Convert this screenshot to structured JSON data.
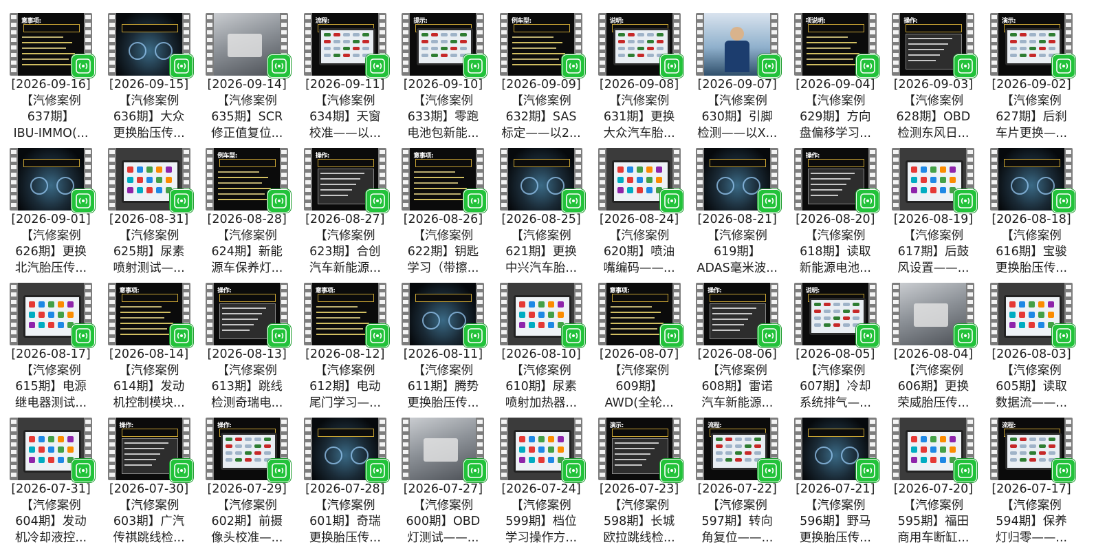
{
  "colors": {
    "badge": "#22c23a",
    "film": "#7d7d7d",
    "text": "#1f1f1f"
  },
  "badge_icon": "wifi-broadcast-icon",
  "items": [
    {
      "date": "[2026-09-16]",
      "l2": "【汽修案例",
      "l3": "637期】",
      "l4": "IBU-IMMO(...",
      "thumb": "dark-text",
      "tag": "意事项:"
    },
    {
      "date": "[2026-09-15]",
      "l2": "【汽修案例",
      "l3": "636期】大众",
      "l4": "更换胎压传...",
      "thumb": "dashboard",
      "tag": "操作:"
    },
    {
      "date": "[2026-09-14]",
      "l2": "【汽修案例",
      "l3": "635期】SCR",
      "l4": "修正值复位...",
      "thumb": "photo-gray",
      "tag": ""
    },
    {
      "date": "[2026-09-11]",
      "l2": "【汽修案例",
      "l3": "634期】天窗",
      "l4": "校准——以...",
      "thumb": "screen",
      "tag": "流程:"
    },
    {
      "date": "[2026-09-10]",
      "l2": "【汽修案例",
      "l3": "633期】零跑",
      "l4": "电池包新能...",
      "thumb": "screen",
      "tag": "提示:"
    },
    {
      "date": "[2026-09-09]",
      "l2": "【汽修案例",
      "l3": "632期】SAS",
      "l4": "标定——以2...",
      "thumb": "dark-text",
      "tag": "例车型:"
    },
    {
      "date": "[2026-09-08]",
      "l2": "【汽修案例",
      "l3": "631期】更换",
      "l4": "大众汽车胎...",
      "thumb": "screen",
      "tag": "说明:"
    },
    {
      "date": "[2026-09-07]",
      "l2": "【汽修案例",
      "l3": "630期】引脚",
      "l4": "检测——以X...",
      "thumb": "photo-blue",
      "tag": ""
    },
    {
      "date": "[2026-09-04]",
      "l2": "【汽修案例",
      "l3": "629期】方向",
      "l4": "盘偏移学习...",
      "thumb": "dark-text",
      "tag": "项说明:"
    },
    {
      "date": "[2026-09-03]",
      "l2": "【汽修案例",
      "l3": "628期】OBD",
      "l4": "检测东风日...",
      "thumb": "plate",
      "tag": "操作:"
    },
    {
      "date": "[2026-09-02]",
      "l2": "【汽修案例",
      "l3": "627期】后刹",
      "l4": "车片更换—...",
      "thumb": "screen",
      "tag": "演示:"
    },
    {
      "date": "[2026-09-01]",
      "l2": "【汽修案例",
      "l3": "626期】更换",
      "l4": "北汽胎压传...",
      "thumb": "dashboard",
      "tag": "说明:"
    },
    {
      "date": "[2026-08-31]",
      "l2": "【汽修案例",
      "l3": "625期】尿素",
      "l4": "喷射测试—...",
      "thumb": "tablet",
      "tag": ""
    },
    {
      "date": "[2026-08-28]",
      "l2": "【汽修案例",
      "l3": "624期】新能",
      "l4": "源车保养灯...",
      "thumb": "dark-text",
      "tag": "例车型:"
    },
    {
      "date": "[2026-08-27]",
      "l2": "【汽修案例",
      "l3": "623期】合创",
      "l4": "汽车新能源...",
      "thumb": "plate",
      "tag": "操作:"
    },
    {
      "date": "[2026-08-26]",
      "l2": "【汽修案例",
      "l3": "622期】钥匙",
      "l4": "学习（带擦...",
      "thumb": "dark-text",
      "tag": "意事项:"
    },
    {
      "date": "[2026-08-25]",
      "l2": "【汽修案例",
      "l3": "621期】更换",
      "l4": "中兴汽车胎...",
      "thumb": "dashboard",
      "tag": "操作:"
    },
    {
      "date": "[2026-08-24]",
      "l2": "【汽修案例",
      "l3": "620期】喷油",
      "l4": "嘴编码——...",
      "thumb": "tablet",
      "tag": ""
    },
    {
      "date": "[2026-08-21]",
      "l2": "【汽修案例",
      "l3": "619期】",
      "l4": "ADAS毫米波...",
      "thumb": "dashboard",
      "tag": "项说明:"
    },
    {
      "date": "[2026-08-20]",
      "l2": "【汽修案例",
      "l3": "618期】读取",
      "l4": "新能源电池...",
      "thumb": "plate",
      "tag": "操作:"
    },
    {
      "date": "[2026-08-19]",
      "l2": "【汽修案例",
      "l3": "617期】后鼓",
      "l4": "风设置——...",
      "thumb": "tablet",
      "tag": "流程:"
    },
    {
      "date": "[2026-08-18]",
      "l2": "【汽修案例",
      "l3": "616期】宝骏",
      "l4": "更换胎压传...",
      "thumb": "dashboard",
      "tag": "操作:"
    },
    {
      "date": "[2026-08-17]",
      "l2": "【汽修案例",
      "l3": "615期】电源",
      "l4": "继电器测试...",
      "thumb": "tablet",
      "tag": ""
    },
    {
      "date": "[2026-08-14]",
      "l2": "【汽修案例",
      "l3": "614期】发动",
      "l4": "机控制模块...",
      "thumb": "dark-text",
      "tag": "意事项:"
    },
    {
      "date": "[2026-08-13]",
      "l2": "【汽修案例",
      "l3": "613期】跳线",
      "l4": "检测奇瑞电...",
      "thumb": "plate",
      "tag": "操作:"
    },
    {
      "date": "[2026-08-12]",
      "l2": "【汽修案例",
      "l3": "612期】电动",
      "l4": "尾门学习—...",
      "thumb": "dark-text",
      "tag": "意事项:"
    },
    {
      "date": "[2026-08-11]",
      "l2": "【汽修案例",
      "l3": "611期】腾势",
      "l4": "更换胎压传...",
      "thumb": "dashboard",
      "tag": "说明:"
    },
    {
      "date": "[2026-08-10]",
      "l2": "【汽修案例",
      "l3": "610期】尿素",
      "l4": "喷射加热器...",
      "thumb": "tablet",
      "tag": ""
    },
    {
      "date": "[2026-08-07]",
      "l2": "【汽修案例",
      "l3": "609期】",
      "l4": "AWD(全轮...",
      "thumb": "dark-text",
      "tag": "意事项:"
    },
    {
      "date": "[2026-08-06]",
      "l2": "【汽修案例",
      "l3": "608期】雷诺",
      "l4": "汽车新能源...",
      "thumb": "plate",
      "tag": "操作:"
    },
    {
      "date": "[2026-08-05]",
      "l2": "【汽修案例",
      "l3": "607期】冷却",
      "l4": "系统排气—...",
      "thumb": "screen",
      "tag": "说明:"
    },
    {
      "date": "[2026-08-04]",
      "l2": "【汽修案例",
      "l3": "606期】更换",
      "l4": "荣威胎压传...",
      "thumb": "photo-gray",
      "tag": "操作:"
    },
    {
      "date": "[2026-08-03]",
      "l2": "【汽修案例",
      "l3": "605期】读取",
      "l4": "数据流——...",
      "thumb": "tablet",
      "tag": "操作:"
    },
    {
      "date": "[2026-07-31]",
      "l2": "【汽修案例",
      "l3": "604期】发动",
      "l4": "机冷却液控...",
      "thumb": "tablet",
      "tag": "流程:"
    },
    {
      "date": "[2026-07-30]",
      "l2": "【汽修案例",
      "l3": "603期】广汽",
      "l4": "传祺跳线检...",
      "thumb": "plate",
      "tag": "操作:"
    },
    {
      "date": "[2026-07-29]",
      "l2": "【汽修案例",
      "l3": "602期】前摄",
      "l4": "像头校准—...",
      "thumb": "screen",
      "tag": "操作:"
    },
    {
      "date": "[2026-07-28]",
      "l2": "【汽修案例",
      "l3": "601期】奇瑞",
      "l4": "更换胎压传...",
      "thumb": "dashboard",
      "tag": "提示:"
    },
    {
      "date": "[2026-07-27]",
      "l2": "【汽修案例",
      "l3": "600期】OBD",
      "l4": "灯测试——...",
      "thumb": "photo-gray",
      "tag": "操作:"
    },
    {
      "date": "[2026-07-24]",
      "l2": "【汽修案例",
      "l3": "599期】档位",
      "l4": "学习操作方...",
      "thumb": "tablet",
      "tag": "演示:"
    },
    {
      "date": "[2026-07-23]",
      "l2": "【汽修案例",
      "l3": "598期】长城",
      "l4": "欧拉跳线检...",
      "thumb": "plate",
      "tag": "演示:"
    },
    {
      "date": "[2026-07-22]",
      "l2": "【汽修案例",
      "l3": "597期】转向",
      "l4": "角复位——...",
      "thumb": "screen",
      "tag": "流程:"
    },
    {
      "date": "[2026-07-21]",
      "l2": "【汽修案例",
      "l3": "596期】野马",
      "l4": "更换胎压传...",
      "thumb": "dashboard",
      "tag": "说明:"
    },
    {
      "date": "[2026-07-20]",
      "l2": "【汽修案例",
      "l3": "595期】福田",
      "l4": "商用车断缸...",
      "thumb": "tablet",
      "tag": ""
    },
    {
      "date": "[2026-07-17]",
      "l2": "【汽修案例",
      "l3": "594期】保养",
      "l4": "灯归零——...",
      "thumb": "screen",
      "tag": "流程:"
    }
  ]
}
